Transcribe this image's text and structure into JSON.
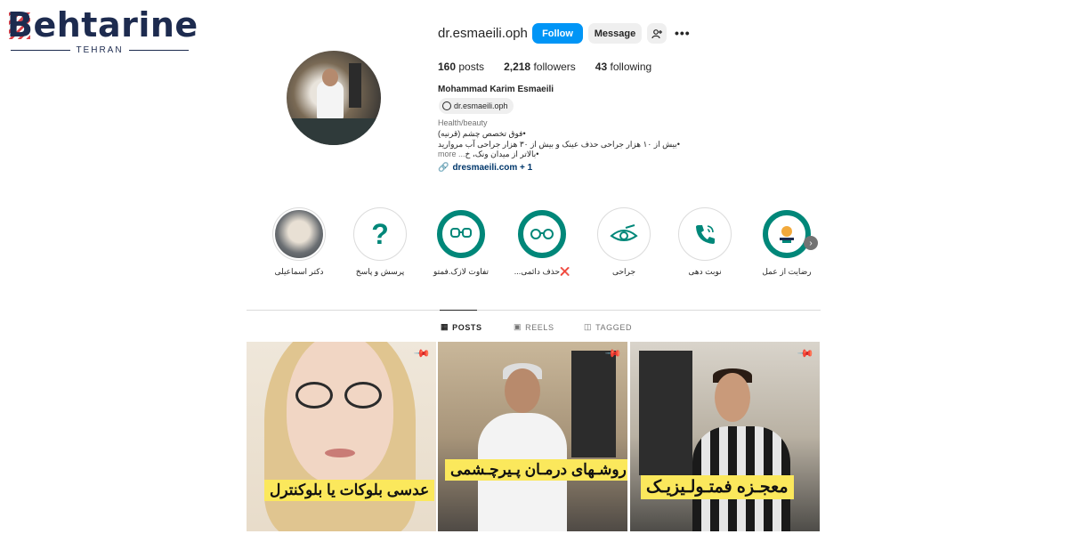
{
  "watermark": {
    "brand": "Behtarine",
    "city": "TEHRAN"
  },
  "profile": {
    "username": "dr.esmaeili.oph",
    "follow_label": "Follow",
    "message_label": "Message",
    "more_label": "•••",
    "posts_count": "160",
    "posts_label": "posts",
    "followers_count": "2,218",
    "followers_label": "followers",
    "following_count": "43",
    "following_label": "following",
    "full_name": "Mohammad Karim Esmaeili",
    "threads_handle": "dr.esmaeili.oph",
    "category": "Health/beauty",
    "bio_line1": "•فوق تخصص چشم (قرنیه)",
    "bio_line2": "•بیش از ۱۰ هزار جراحی حذف عینک و بیش از ۳۰ هزار جراحی آب مروارید",
    "bio_line3": "•بالاتر از میدان ونک، خ",
    "bio_more": "... more",
    "link_text": "dresmaeili.com + 1"
  },
  "highlights": [
    {
      "label": "دکتر اسماعیلی",
      "icon": "doctor-photo"
    },
    {
      "label": "پرسش و پاسخ",
      "icon": "question-mark-icon"
    },
    {
      "label": "تفاوت لازک.فمتو",
      "icon": "binocular-icon"
    },
    {
      "label": "❌حذف دائمی...",
      "icon": "glasses-icon"
    },
    {
      "label": "جراحی",
      "icon": "eye-icon"
    },
    {
      "label": "نوبت دهی",
      "icon": "phone-icon"
    },
    {
      "label": "رضایت از عمل",
      "icon": "award-icon"
    }
  ],
  "tabs": {
    "posts": "POSTS",
    "reels": "REELS",
    "tagged": "TAGGED"
  },
  "posts": [
    {
      "caption": "عدسی بلوکات یا بلوکنترل"
    },
    {
      "caption": "روشـهای درمـان پـیرچـشمی"
    },
    {
      "caption": "معجـزه فمتـولـیزیـک"
    }
  ],
  "colors": {
    "accent": "#0095f6",
    "teal": "#008779",
    "caption_bg": "#fbe85c"
  }
}
